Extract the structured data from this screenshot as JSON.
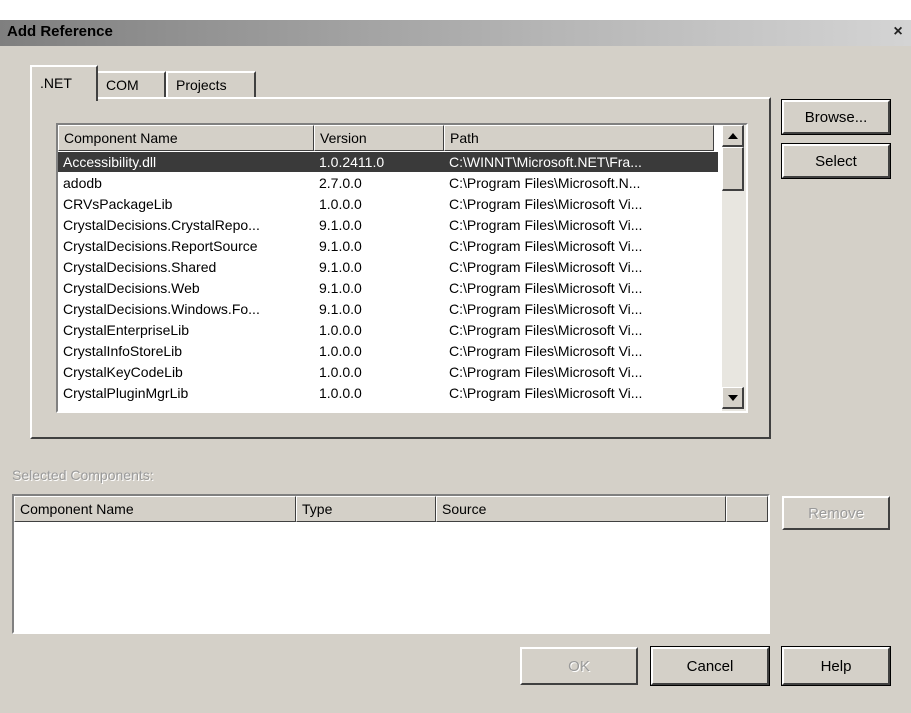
{
  "window": {
    "title": "Add Reference",
    "close_label": "×"
  },
  "tabs": [
    {
      "label": ".NET",
      "active": true
    },
    {
      "label": "COM",
      "active": false
    },
    {
      "label": "Projects",
      "active": false
    }
  ],
  "components": {
    "columns": [
      "Component Name",
      "Version",
      "Path"
    ],
    "rows": [
      {
        "name": "Accessibility.dll",
        "version": "1.0.2411.0",
        "path": "C:\\WINNT\\Microsoft.NET\\Fra...",
        "selected": true
      },
      {
        "name": "adodb",
        "version": "2.7.0.0",
        "path": "C:\\Program Files\\Microsoft.N..."
      },
      {
        "name": "CRVsPackageLib",
        "version": "1.0.0.0",
        "path": "C:\\Program Files\\Microsoft Vi..."
      },
      {
        "name": "CrystalDecisions.CrystalRepo...",
        "version": "9.1.0.0",
        "path": "C:\\Program Files\\Microsoft Vi..."
      },
      {
        "name": "CrystalDecisions.ReportSource",
        "version": "9.1.0.0",
        "path": "C:\\Program Files\\Microsoft Vi..."
      },
      {
        "name": "CrystalDecisions.Shared",
        "version": "9.1.0.0",
        "path": "C:\\Program Files\\Microsoft Vi..."
      },
      {
        "name": "CrystalDecisions.Web",
        "version": "9.1.0.0",
        "path": "C:\\Program Files\\Microsoft Vi..."
      },
      {
        "name": "CrystalDecisions.Windows.Fo...",
        "version": "9.1.0.0",
        "path": "C:\\Program Files\\Microsoft Vi..."
      },
      {
        "name": "CrystalEnterpriseLib",
        "version": "1.0.0.0",
        "path": "C:\\Program Files\\Microsoft Vi..."
      },
      {
        "name": "CrystalInfoStoreLib",
        "version": "1.0.0.0",
        "path": "C:\\Program Files\\Microsoft Vi..."
      },
      {
        "name": "CrystalKeyCodeLib",
        "version": "1.0.0.0",
        "path": "C:\\Program Files\\Microsoft Vi..."
      },
      {
        "name": "CrystalPluginMgrLib",
        "version": "1.0.0.0",
        "path": "C:\\Program Files\\Microsoft Vi..."
      }
    ]
  },
  "side_buttons": {
    "browse": "Browse...",
    "select": "Select",
    "remove": "Remove"
  },
  "selected_components": {
    "label": "Selected Components:",
    "columns": [
      "Component Name",
      "Type",
      "Source"
    ]
  },
  "footer_buttons": {
    "ok": "OK",
    "cancel": "Cancel",
    "help": "Help"
  },
  "colors": {
    "selection_bg": "#3a3a3a",
    "dialog_bg": "#d4d0c8"
  }
}
